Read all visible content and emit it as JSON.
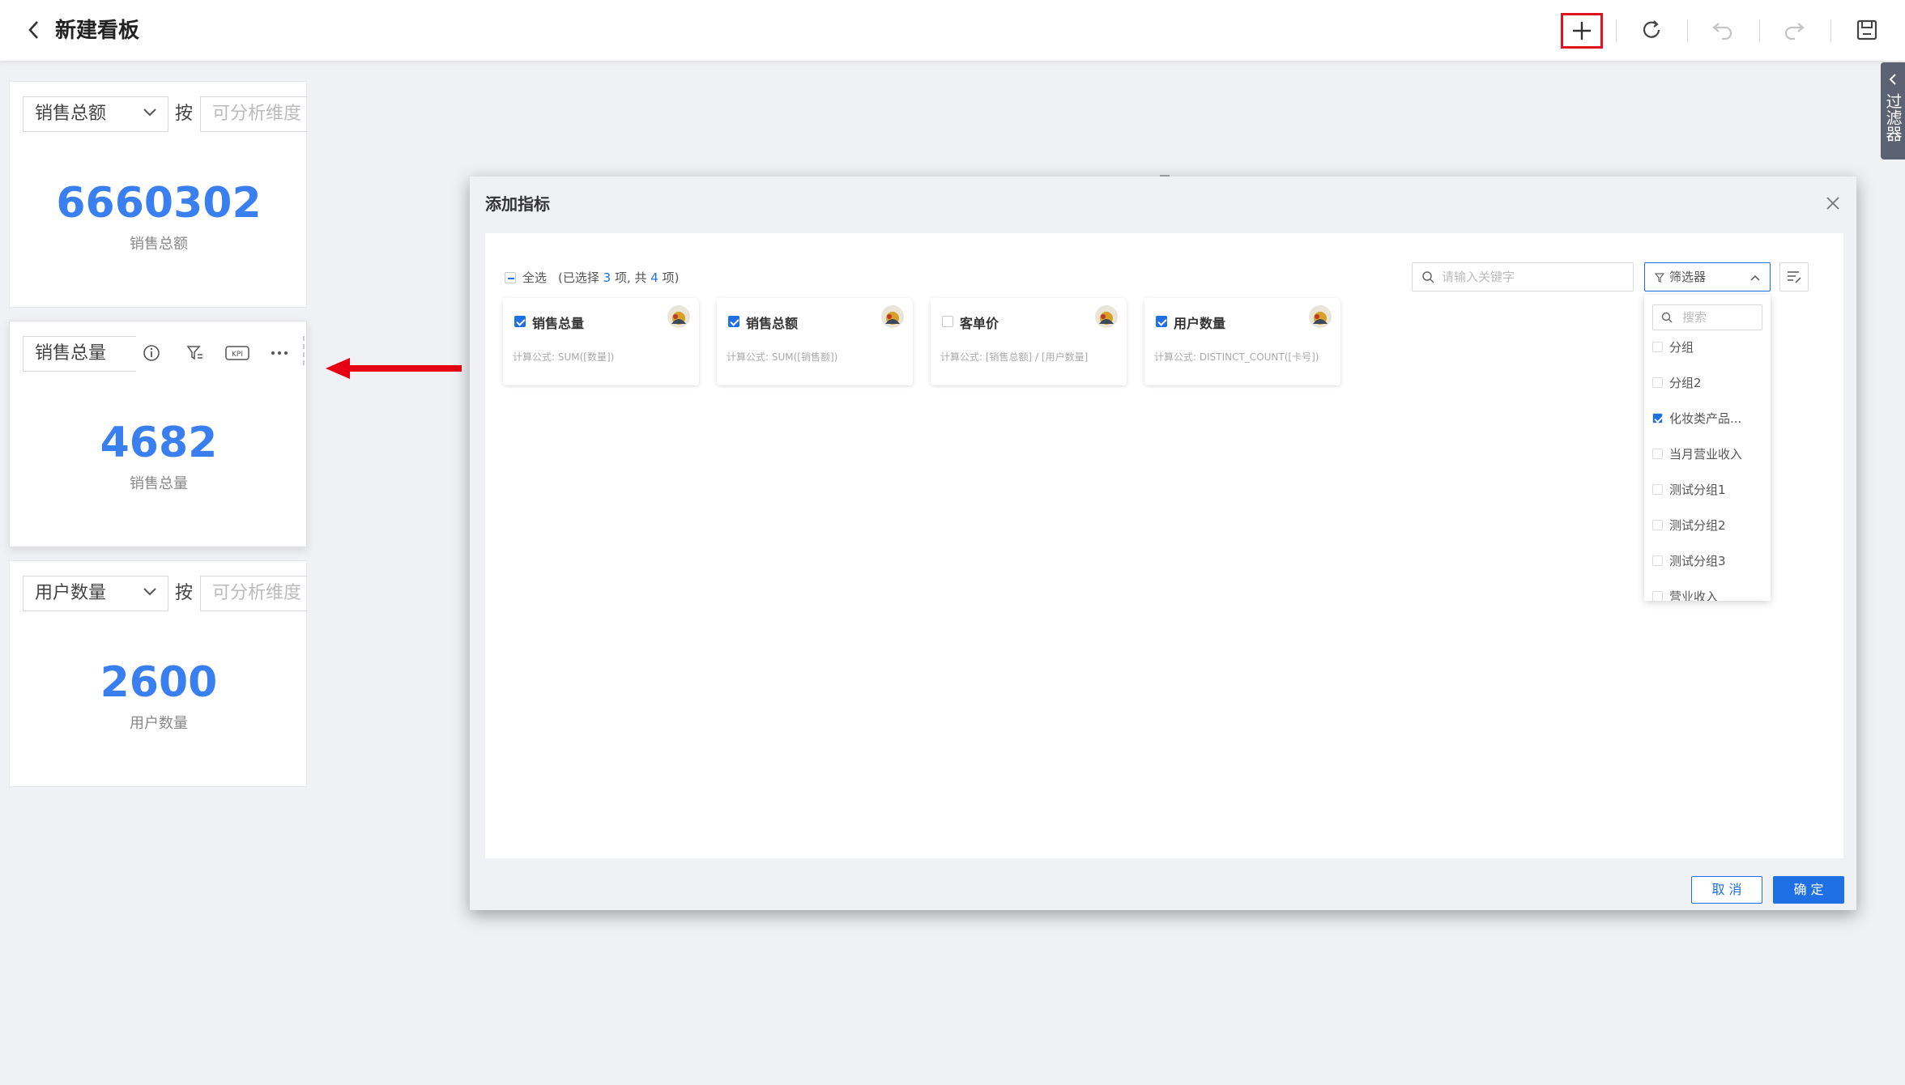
{
  "header": {
    "title": "新建看板",
    "icons": [
      "back-icon",
      "plus-icon",
      "refresh-icon",
      "undo-icon",
      "redo-icon",
      "save-icon"
    ]
  },
  "widgets": [
    {
      "metric": "销售总额",
      "by": "按",
      "dimension_placeholder": "可分析维度",
      "value": "6660302",
      "label": "销售总额"
    },
    {
      "metric": "销售总量",
      "value": "4682",
      "label": "销售总量",
      "kpi": "KPI",
      "tools": [
        "info-icon",
        "filter-icon",
        "kpi-icon",
        "more-icon"
      ]
    },
    {
      "metric": "用户数量",
      "by": "按",
      "dimension_placeholder": "可分析维度",
      "value": "2600",
      "label": "用户数量"
    }
  ],
  "filter_tab": {
    "label": "过滤器"
  },
  "dialog": {
    "title": "添加指标",
    "select_all": "全选",
    "summary_prefix": "(已选择 ",
    "selected_count": "3",
    "summary_mid": " 项, 共 ",
    "total_count": "4",
    "summary_suffix": " 项)",
    "search_placeholder": "请输入关键字",
    "filter_label": "筛选器",
    "filter_search_placeholder": "搜索",
    "filter_options": [
      {
        "label": "分组",
        "checked": false
      },
      {
        "label": "分组2",
        "checked": false
      },
      {
        "label": "化妆类产品...",
        "checked": true
      },
      {
        "label": "当月营业收入",
        "checked": false
      },
      {
        "label": "测试分组1",
        "checked": false
      },
      {
        "label": "测试分组2",
        "checked": false
      },
      {
        "label": "测试分组3",
        "checked": false
      },
      {
        "label": "营业收入",
        "checked": false
      }
    ],
    "metrics": [
      {
        "name": "销售总量",
        "checked": true,
        "formula": "计算公式: SUM([数量])"
      },
      {
        "name": "销售总额",
        "checked": true,
        "formula": "计算公式: SUM([销售额])"
      },
      {
        "name": "客单价",
        "checked": false,
        "formula": "计算公式: [销售总额] / [用户数量]"
      },
      {
        "name": "用户数量",
        "checked": true,
        "formula": "计算公式: DISTINCT_COUNT([卡号])"
      }
    ],
    "cancel_label": "取 消",
    "ok_label": "确 定"
  },
  "colors": {
    "accent": "#1f6fe5",
    "value_blue": "#3a7ff0",
    "highlight_red": "#e0141e"
  }
}
